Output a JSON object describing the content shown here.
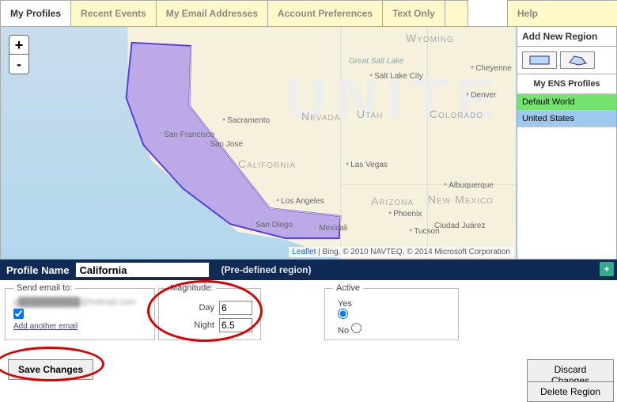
{
  "tabs": {
    "my_profiles": "My Profiles",
    "recent_events": "Recent Events",
    "my_email": "My Email Addresses",
    "account_prefs": "Account Preferences",
    "text_only": "Text Only",
    "help": "Help"
  },
  "zoom": {
    "in": "+",
    "out": "-"
  },
  "map": {
    "bg_text": "UNITE",
    "states": {
      "california": "California",
      "nevada": "Nevada",
      "utah": "Utah",
      "colorado": "Colorado",
      "arizona": "Arizona",
      "new_mexico": "New Mexico",
      "wyoming": "Wyoming"
    },
    "cities": {
      "san_francisco": "San Francisco",
      "san_jose": "San Jose",
      "sacramento": "Sacramento",
      "los_angeles": "Los Angeles",
      "san_diego": "San Diego",
      "mexicali": "Mexicali",
      "las_vegas": "Las Vegas",
      "phoenix": "Phoenix",
      "tucson": "Tucson",
      "albuquerque": "Albuquerque",
      "ciudad_juarez": "Ciudad Juárez",
      "denver": "Denver",
      "salt_lake_city": "Salt Lake City",
      "great_salt_lake": "Great Salt Lake",
      "cheyenne": "Cheyenne"
    },
    "attr": {
      "leaflet": "Leaflet",
      "rest": " | Bing, © 2010 NAVTEQ, © 2014 Microsoft Corporation"
    }
  },
  "right": {
    "add_region": "Add New Region",
    "ens_heading": "My ENS Profiles",
    "profiles": {
      "default_world": "Default World",
      "united_states": "United States"
    }
  },
  "profbar": {
    "label": "Profile Name",
    "value": "California",
    "predef": "(Pre-defined region)"
  },
  "form": {
    "email_legend": "Send email to:",
    "email_blurred": "g██████████@hotmail.com",
    "add_email": "Add another email",
    "mag_legend": "Magnitude:",
    "day_label": "Day",
    "day_value": "6",
    "night_label": "Night",
    "night_value": "6.5",
    "active_legend": "Active",
    "yes": "Yes",
    "no": "No",
    "active_selected": "yes"
  },
  "buttons": {
    "save": "Save Changes",
    "discard": "Discard Changes",
    "delete": "Delete Region"
  }
}
